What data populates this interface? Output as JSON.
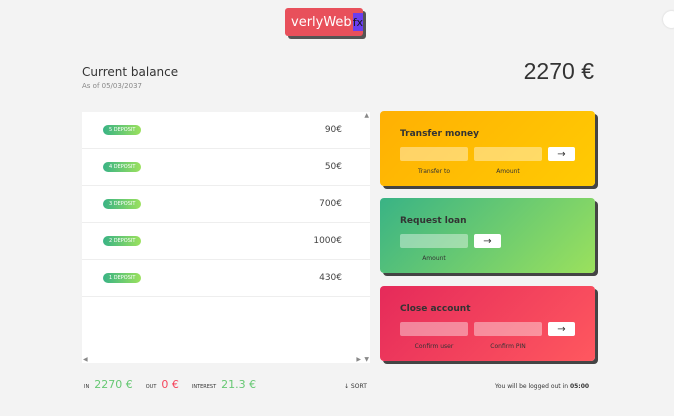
{
  "logo": {
    "text": "verlyWeb",
    "mark": "fx"
  },
  "balance": {
    "title": "Current balance",
    "date": "As of 05/03/2037",
    "value": "2270 €"
  },
  "movements": [
    {
      "type": "5 DEPOSIT",
      "amount": "90€"
    },
    {
      "type": "4 DEPOSIT",
      "amount": "50€"
    },
    {
      "type": "3 DEPOSIT",
      "amount": "700€"
    },
    {
      "type": "2 DEPOSIT",
      "amount": "1000€"
    },
    {
      "type": "1 DEPOSIT",
      "amount": "430€"
    }
  ],
  "transfer": {
    "title": "Transfer money",
    "to_label": "Transfer to",
    "amount_label": "Amount",
    "button": "→"
  },
  "loan": {
    "title": "Request loan",
    "amount_label": "Amount",
    "button": "→"
  },
  "close": {
    "title": "Close account",
    "user_label": "Confirm user",
    "pin_label": "Confirm PIN",
    "button": "→"
  },
  "summary": {
    "in_label": "In",
    "in_value": "2270 €",
    "out_label": "Out",
    "out_value": "0 €",
    "interest_label": "Interest",
    "interest_value": "21.3 €",
    "sort": "↓ SORT"
  },
  "logout": {
    "text": "You will be logged out in ",
    "time": "05:00"
  },
  "scroll": {
    "up": "▲",
    "down": "▼",
    "left": "◀",
    "right": "▶"
  },
  "colors": {
    "transfer": "#ffb003",
    "loan": "#39b385",
    "close": "#e52a5a",
    "in": "#66c873",
    "out": "#f5465d"
  }
}
